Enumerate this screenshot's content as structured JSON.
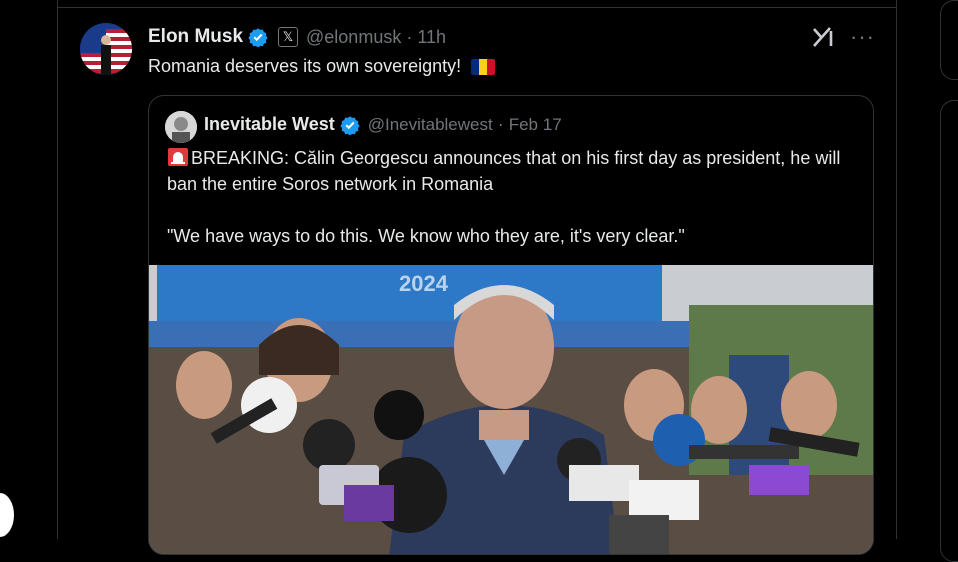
{
  "tweet": {
    "author_name": "Elon Musk",
    "handle": "@elonmusk",
    "time": "11h",
    "text": "Romania deserves its own sovereignty!",
    "flag_colors": [
      "#002B7F",
      "#FCD116",
      "#CE1126"
    ]
  },
  "quote": {
    "author_name": "Inevitable West",
    "handle": "@Inevitablewest",
    "date": "Feb 17",
    "text_line1": "BREAKING: Călin Georgescu announces that on his first day as president, he will ban the entire Soros network in Romania",
    "text_line2": "\"We have ways to do this. We know who they are, it's very clear.\"",
    "photo_banner_text": "2024"
  },
  "icons": {
    "verified": "verified-badge-icon",
    "affiliate": "x-logo-icon",
    "grok": "grok-icon",
    "more": "more-options-icon"
  },
  "colors": {
    "verified": "#1d9bf0",
    "muted": "#71767b",
    "border": "#2f3336"
  }
}
